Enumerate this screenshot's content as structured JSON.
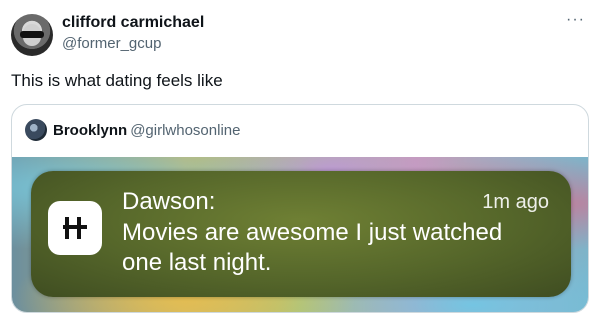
{
  "tweet": {
    "author_name": "clifford carmichael",
    "author_handle": "@former_gcup",
    "more_icon": "···",
    "text": "This is what dating feels like"
  },
  "quote": {
    "author_name": "Brooklynn",
    "author_handle": "@girlwhosonline",
    "notification": {
      "app_icon": "H-logo-icon",
      "sender": "Dawson:",
      "time": "1m ago",
      "message": "Movies are awesome I just watched one last night."
    }
  }
}
